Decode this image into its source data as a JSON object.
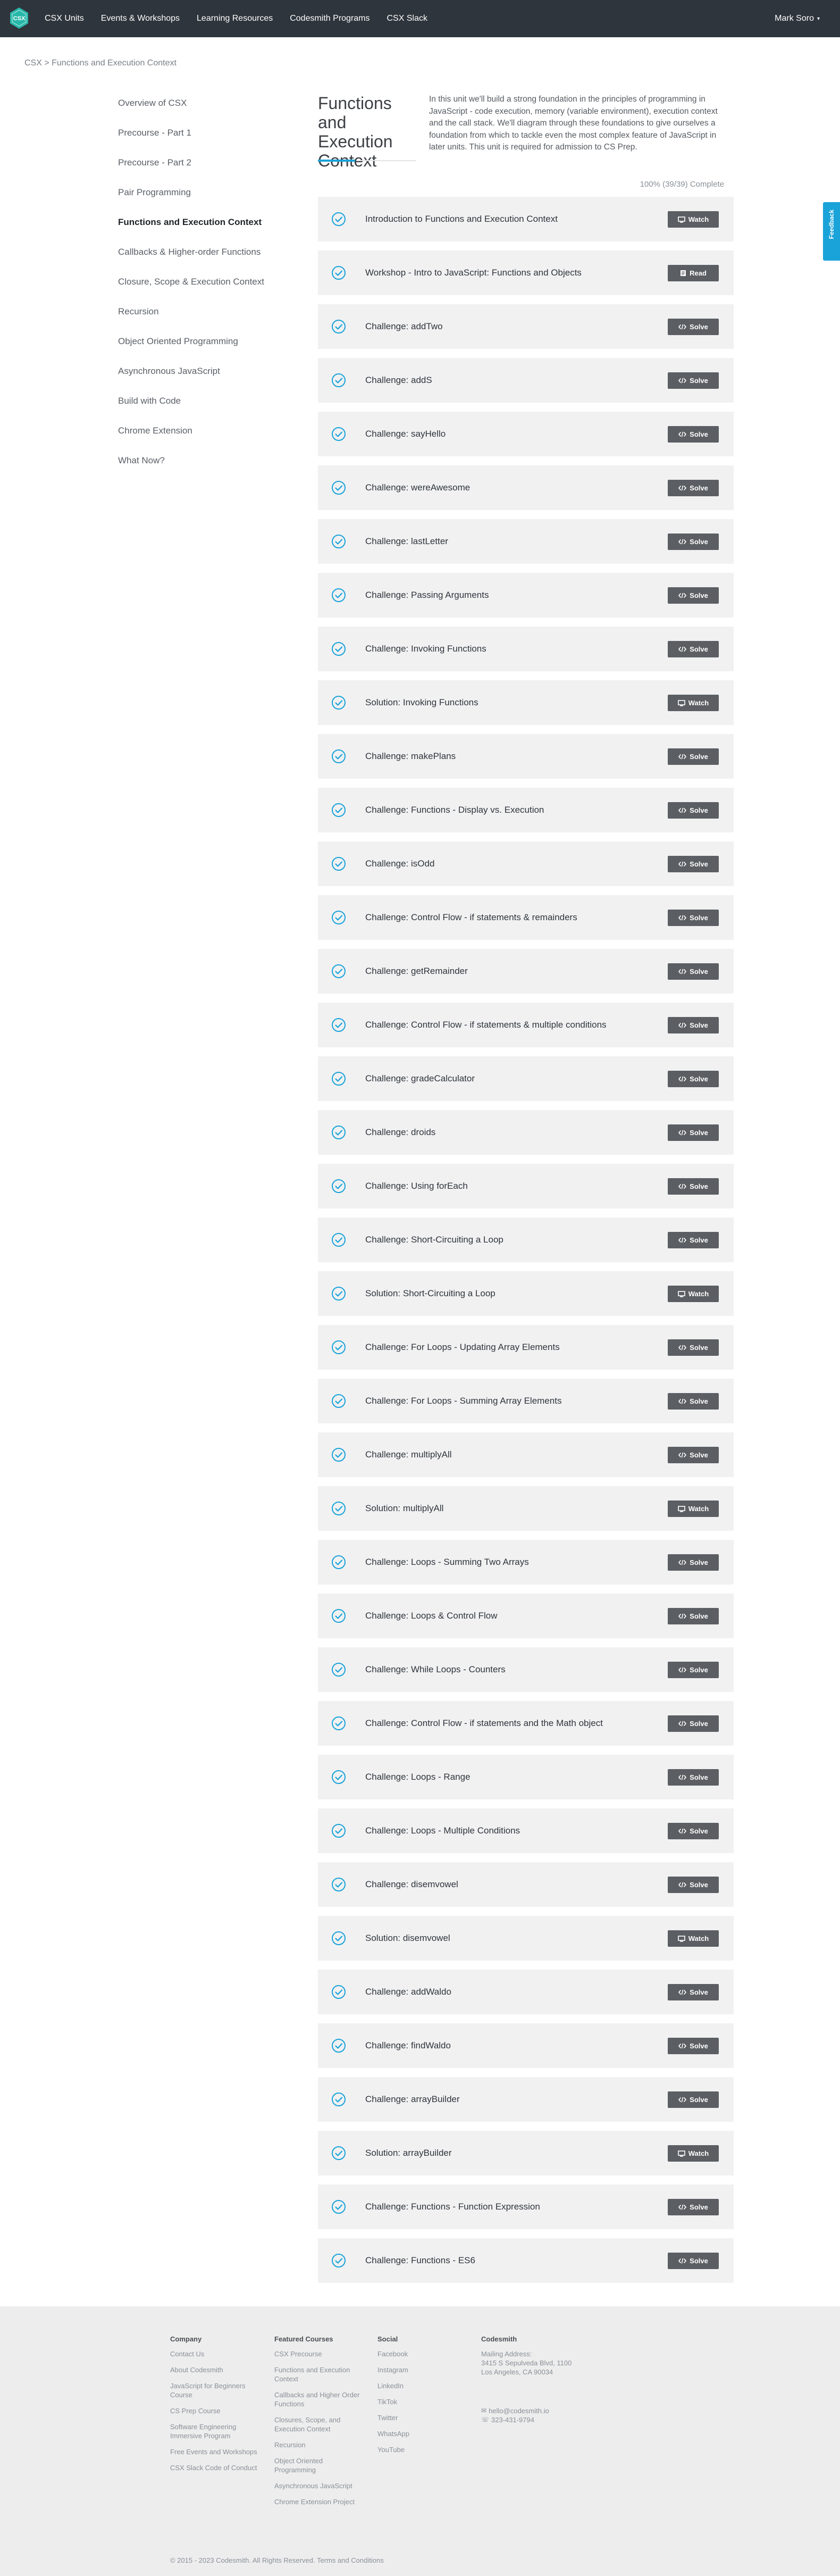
{
  "nav": {
    "logo_text": "CSX",
    "links": [
      "CSX Units",
      "Events & Workshops",
      "Learning Resources",
      "Codesmith Programs",
      "CSX Slack"
    ],
    "user": "Mark Soro"
  },
  "breadcrumb": "CSX > Functions and Execution Context",
  "sidebar": {
    "items": [
      "Overview of CSX",
      "Precourse - Part 1",
      "Precourse - Part 2",
      "Pair Programming",
      "Functions and Execution Context",
      "Callbacks & Higher-order Functions",
      "Closure, Scope & Execution Context",
      "Recursion",
      "Object Oriented Programming",
      "Asynchronous JavaScript",
      "Build with Code",
      "Chrome Extension",
      "What Now?"
    ],
    "active": "Functions and Execution Context"
  },
  "unit": {
    "title": "Functions and Execution Context",
    "description": "In this unit we'll build a strong foundation in the principles of programming in JavaScript - code execution, memory (variable environment), execution context and the call stack. We'll diagram through these foundations to give ourselves a foundation from which to tackle even the most complex feature of JavaScript in later units. This unit is required for admission to CS Prep.",
    "progress": "100% (39/39) Complete",
    "progress_value": 1.0
  },
  "items": [
    {
      "title": "Introduction to Functions and Execution Context",
      "action": "Watch"
    },
    {
      "title": "Workshop - Intro to JavaScript: Functions and Objects",
      "action": "Read"
    },
    {
      "title": "Challenge: addTwo",
      "action": "Solve"
    },
    {
      "title": "Challenge: addS",
      "action": "Solve"
    },
    {
      "title": "Challenge: sayHello",
      "action": "Solve"
    },
    {
      "title": "Challenge: wereAwesome",
      "action": "Solve"
    },
    {
      "title": "Challenge: lastLetter",
      "action": "Solve"
    },
    {
      "title": "Challenge: Passing Arguments",
      "action": "Solve"
    },
    {
      "title": "Challenge: Invoking Functions",
      "action": "Solve"
    },
    {
      "title": "Solution: Invoking Functions",
      "action": "Watch"
    },
    {
      "title": "Challenge: makePlans",
      "action": "Solve"
    },
    {
      "title": "Challenge: Functions - Display vs. Execution",
      "action": "Solve"
    },
    {
      "title": "Challenge: isOdd",
      "action": "Solve"
    },
    {
      "title": "Challenge: Control Flow - if statements & remainders",
      "action": "Solve"
    },
    {
      "title": "Challenge: getRemainder",
      "action": "Solve"
    },
    {
      "title": "Challenge: Control Flow - if statements & multiple conditions",
      "action": "Solve"
    },
    {
      "title": "Challenge: gradeCalculator",
      "action": "Solve"
    },
    {
      "title": "Challenge: droids",
      "action": "Solve"
    },
    {
      "title": "Challenge: Using forEach",
      "action": "Solve"
    },
    {
      "title": "Challenge: Short-Circuiting a Loop",
      "action": "Solve"
    },
    {
      "title": "Solution: Short-Circuiting a Loop",
      "action": "Watch"
    },
    {
      "title": "Challenge: For Loops - Updating Array Elements",
      "action": "Solve"
    },
    {
      "title": "Challenge: For Loops - Summing Array Elements",
      "action": "Solve"
    },
    {
      "title": "Challenge: multiplyAll",
      "action": "Solve"
    },
    {
      "title": "Solution: multiplyAll",
      "action": "Watch"
    },
    {
      "title": "Challenge: Loops - Summing Two Arrays",
      "action": "Solve"
    },
    {
      "title": "Challenge: Loops & Control Flow",
      "action": "Solve"
    },
    {
      "title": "Challenge: While Loops - Counters",
      "action": "Solve"
    },
    {
      "title": "Challenge: Control Flow - if statements and the Math object",
      "action": "Solve"
    },
    {
      "title": "Challenge: Loops - Range",
      "action": "Solve"
    },
    {
      "title": "Challenge: Loops - Multiple Conditions",
      "action": "Solve"
    },
    {
      "title": "Challenge: disemvowel",
      "action": "Solve"
    },
    {
      "title": "Solution: disemvowel",
      "action": "Watch"
    },
    {
      "title": "Challenge: addWaldo",
      "action": "Solve"
    },
    {
      "title": "Challenge: findWaldo",
      "action": "Solve"
    },
    {
      "title": "Challenge: arrayBuilder",
      "action": "Solve"
    },
    {
      "title": "Solution: arrayBuilder",
      "action": "Watch"
    },
    {
      "title": "Challenge: Functions - Function Expression",
      "action": "Solve"
    },
    {
      "title": "Challenge: Functions - ES6",
      "action": "Solve"
    }
  ],
  "feedback_label": "Feedback",
  "footer": {
    "columns": [
      {
        "heading": "Company",
        "links": [
          "Contact Us",
          "About Codesmith",
          "JavaScript for Beginners Course",
          "CS Prep Course",
          "Software Engineering Immersive Program",
          "Free Events and Workshops",
          "CSX Slack Code of Conduct"
        ]
      },
      {
        "heading": "Featured Courses",
        "links": [
          "CSX Precourse",
          "Functions and Execution Context",
          "Callbacks and Higher Order Functions",
          "Closures, Scope, and Execution Context",
          "Recursion",
          "Object Oriented Programming",
          "Asynchronous JavaScript",
          "Chrome Extension Project"
        ]
      },
      {
        "heading": "Social",
        "links": [
          "Facebook",
          "Instagram",
          "LinkedIn",
          "TikTok",
          "Twitter",
          "WhatsApp",
          "YouTube"
        ]
      }
    ],
    "codesmith": {
      "heading": "Codesmith",
      "mailing_label": "Mailing Address:",
      "address1": "3415 S Sepulveda Blvd, 1100",
      "address2": "Los Angeles, CA 90034",
      "email": "hello@codesmith.io",
      "phone": "323-431-9794"
    },
    "copyright": "© 2015 - 2023 Codesmith. All Rights Reserved. Terms and Conditions"
  },
  "colors": {
    "nav_bg": "#2f353c",
    "accent": "#1aa3d9",
    "row_bg": "#f1f1f2",
    "button_bg": "#5b5f63",
    "footer_bg": "#ededee",
    "logo": "#28b6a8"
  }
}
